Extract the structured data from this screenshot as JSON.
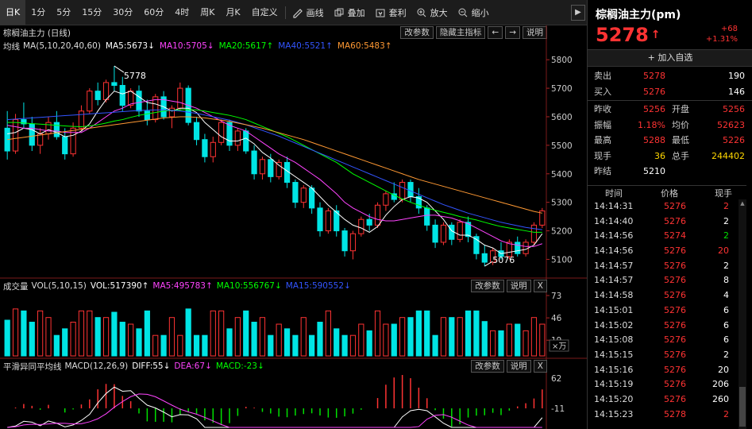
{
  "toolbar": {
    "periods": [
      "日K",
      "1分",
      "5分",
      "15分",
      "30分",
      "60分",
      "4时",
      "周K",
      "月K",
      "自定义"
    ],
    "active_period": "日K",
    "tools": [
      {
        "label": "画线",
        "icon": "pencil-icon"
      },
      {
        "label": "叠加",
        "icon": "overlay-icon"
      },
      {
        "label": "套利",
        "icon": "arbitrage-icon"
      },
      {
        "label": "放大",
        "icon": "zoom-in-icon"
      },
      {
        "label": "缩小",
        "icon": "zoom-out-icon"
      }
    ],
    "more": "▶"
  },
  "main_pane": {
    "title": "棕榈油主力 (日线)",
    "buttons": [
      "改参数",
      "隐藏主指标",
      "←",
      "→",
      "说明"
    ],
    "ma_label": "均线",
    "ma_params": "MA(5,10,20,40,60)",
    "ma_values": [
      {
        "text": "MA5:5673↓",
        "color": "#ffffff"
      },
      {
        "text": "MA10:5705↓",
        "color": "#ff44ff"
      },
      {
        "text": "MA20:5617↑",
        "color": "#00ff00"
      },
      {
        "text": "MA40:5521↑",
        "color": "#3355ff"
      },
      {
        "text": "MA60:5483↑",
        "color": "#ff9933"
      }
    ],
    "high_label": "5778",
    "low_label": "5076",
    "y_ticks": [
      "5800",
      "5700",
      "5600",
      "5500",
      "5400",
      "5300",
      "5200",
      "5100"
    ]
  },
  "vol_pane": {
    "label": "成交量",
    "params": "VOL(5,10,15)",
    "values": [
      {
        "text": "VOL:517390↑",
        "color": "#ffffff"
      },
      {
        "text": "MA5:495783↑",
        "color": "#ff44ff"
      },
      {
        "text": "MA10:556767↓",
        "color": "#00ff00"
      },
      {
        "text": "MA15:590552↓",
        "color": "#3355ff"
      }
    ],
    "buttons": [
      "改参数",
      "说明",
      "X"
    ],
    "y_ticks": [
      "73",
      "46",
      "19"
    ],
    "unit": "×万"
  },
  "macd_pane": {
    "label": "平滑异同平均线",
    "params": "MACD(12,26,9)",
    "values": [
      {
        "text": "DIFF:55↓",
        "color": "#ffffff"
      },
      {
        "text": "DEA:67↓",
        "color": "#ff44ff"
      },
      {
        "text": "MACD:-23↓",
        "color": "#00ff00"
      }
    ],
    "buttons": [
      "改参数",
      "说明",
      "X"
    ],
    "y_ticks": [
      "62",
      "-11"
    ]
  },
  "quote": {
    "name": "棕榈油主力(pm)",
    "price": "5278",
    "arrow": "↑",
    "change": "+68",
    "change_pct": "+1.31%",
    "add_fav": "+ 加入自选",
    "sell_label": "卖出",
    "sell_price": "5278",
    "sell_vol": "190",
    "buy_label": "买入",
    "buy_price": "5276",
    "buy_vol": "146",
    "rows": [
      {
        "l1": "昨收",
        "v1": "5256",
        "c1": "red",
        "l2": "开盘",
        "v2": "5256",
        "c2": "red"
      },
      {
        "l1": "振幅",
        "v1": "1.18%",
        "c1": "red",
        "l2": "均价",
        "v2": "52623",
        "c2": "red"
      },
      {
        "l1": "最高",
        "v1": "5288",
        "c1": "red",
        "l2": "最低",
        "v2": "5226",
        "c2": "red"
      },
      {
        "l1": "现手",
        "v1": "36",
        "c1": "yellow",
        "l2": "总手",
        "v2": "244402",
        "c2": "yellow"
      },
      {
        "l1": "昨结",
        "v1": "5210",
        "c1": "white",
        "l2": "",
        "v2": "",
        "c2": "white"
      }
    ]
  },
  "ticks": {
    "headers": [
      "时间",
      "价格",
      "现手"
    ],
    "rows": [
      {
        "time": "14:14:31",
        "price": "5276",
        "vol": "2",
        "color": "red"
      },
      {
        "time": "14:14:40",
        "price": "5276",
        "vol": "2",
        "color": "white"
      },
      {
        "time": "14:14:56",
        "price": "5274",
        "vol": "2",
        "color": "green"
      },
      {
        "time": "14:14:56",
        "price": "5276",
        "vol": "20",
        "color": "red"
      },
      {
        "time": "14:14:57",
        "price": "5276",
        "vol": "2",
        "color": "white"
      },
      {
        "time": "14:14:57",
        "price": "5276",
        "vol": "8",
        "color": "white"
      },
      {
        "time": "14:14:58",
        "price": "5276",
        "vol": "4",
        "color": "white"
      },
      {
        "time": "14:15:01",
        "price": "5276",
        "vol": "6",
        "color": "white"
      },
      {
        "time": "14:15:02",
        "price": "5276",
        "vol": "6",
        "color": "white"
      },
      {
        "time": "14:15:08",
        "price": "5276",
        "vol": "6",
        "color": "white"
      },
      {
        "time": "14:15:15",
        "price": "5276",
        "vol": "2",
        "color": "white"
      },
      {
        "time": "14:15:16",
        "price": "5276",
        "vol": "20",
        "color": "white"
      },
      {
        "time": "14:15:19",
        "price": "5276",
        "vol": "206",
        "color": "white"
      },
      {
        "time": "14:15:20",
        "price": "5276",
        "vol": "260",
        "color": "white"
      },
      {
        "time": "14:15:23",
        "price": "5278",
        "vol": "2",
        "color": "red"
      }
    ]
  },
  "chart_data": {
    "type": "candlestick",
    "title": "棕榈油主力 (日线)",
    "ylim": [
      5040,
      5820
    ],
    "ohlc": [
      [
        5560,
        5620,
        5450,
        5480
      ],
      [
        5480,
        5610,
        5470,
        5590
      ],
      [
        5590,
        5650,
        5560,
        5575
      ],
      [
        5575,
        5600,
        5480,
        5500
      ],
      [
        5500,
        5560,
        5470,
        5540
      ],
      [
        5540,
        5600,
        5520,
        5580
      ],
      [
        5580,
        5620,
        5520,
        5530
      ],
      [
        5530,
        5560,
        5450,
        5470
      ],
      [
        5470,
        5580,
        5460,
        5560
      ],
      [
        5560,
        5640,
        5550,
        5620
      ],
      [
        5620,
        5700,
        5610,
        5690
      ],
      [
        5690,
        5720,
        5640,
        5660
      ],
      [
        5660,
        5730,
        5650,
        5720
      ],
      [
        5720,
        5778,
        5690,
        5710
      ],
      [
        5710,
        5740,
        5620,
        5640
      ],
      [
        5640,
        5700,
        5630,
        5690
      ],
      [
        5690,
        5710,
        5600,
        5620
      ],
      [
        5620,
        5660,
        5570,
        5590
      ],
      [
        5590,
        5680,
        5580,
        5670
      ],
      [
        5670,
        5690,
        5590,
        5600
      ],
      [
        5600,
        5640,
        5560,
        5630
      ],
      [
        5630,
        5720,
        5620,
        5700
      ],
      [
        5700,
        5710,
        5570,
        5580
      ],
      [
        5580,
        5600,
        5500,
        5520
      ],
      [
        5520,
        5540,
        5440,
        5460
      ],
      [
        5460,
        5530,
        5440,
        5510
      ],
      [
        5510,
        5590,
        5500,
        5580
      ],
      [
        5580,
        5590,
        5480,
        5500
      ],
      [
        5500,
        5560,
        5480,
        5550
      ],
      [
        5550,
        5560,
        5470,
        5480
      ],
      [
        5480,
        5500,
        5380,
        5400
      ],
      [
        5400,
        5460,
        5380,
        5450
      ],
      [
        5450,
        5470,
        5370,
        5390
      ],
      [
        5390,
        5450,
        5380,
        5440
      ],
      [
        5440,
        5460,
        5350,
        5370
      ],
      [
        5370,
        5380,
        5280,
        5300
      ],
      [
        5300,
        5360,
        5280,
        5350
      ],
      [
        5350,
        5360,
        5260,
        5280
      ],
      [
        5280,
        5300,
        5180,
        5200
      ],
      [
        5200,
        5280,
        5190,
        5270
      ],
      [
        5270,
        5290,
        5180,
        5200
      ],
      [
        5200,
        5210,
        5110,
        5130
      ],
      [
        5130,
        5200,
        5100,
        5190
      ],
      [
        5190,
        5250,
        5180,
        5240
      ],
      [
        5240,
        5260,
        5200,
        5220
      ],
      [
        5220,
        5300,
        5210,
        5290
      ],
      [
        5290,
        5340,
        5270,
        5330
      ],
      [
        5330,
        5370,
        5300,
        5310
      ],
      [
        5310,
        5380,
        5300,
        5370
      ],
      [
        5370,
        5380,
        5300,
        5320
      ],
      [
        5320,
        5350,
        5260,
        5280
      ],
      [
        5280,
        5290,
        5200,
        5220
      ],
      [
        5220,
        5240,
        5140,
        5160
      ],
      [
        5160,
        5230,
        5150,
        5220
      ],
      [
        5220,
        5230,
        5150,
        5170
      ],
      [
        5170,
        5240,
        5160,
        5230
      ],
      [
        5230,
        5250,
        5160,
        5180
      ],
      [
        5180,
        5190,
        5100,
        5120
      ],
      [
        5120,
        5150,
        5076,
        5090
      ],
      [
        5090,
        5140,
        5080,
        5130
      ],
      [
        5130,
        5160,
        5100,
        5110
      ],
      [
        5110,
        5170,
        5100,
        5160
      ],
      [
        5160,
        5180,
        5110,
        5120
      ],
      [
        5120,
        5170,
        5110,
        5160
      ],
      [
        5160,
        5230,
        5150,
        5220
      ],
      [
        5220,
        5280,
        5210,
        5270
      ]
    ],
    "series": [
      {
        "name": "MA5",
        "color": "#ffffff",
        "values": [
          5540,
          5545,
          5560,
          5555,
          5540,
          5555,
          5545,
          5530,
          5535,
          5550,
          5575,
          5620,
          5660,
          5690,
          5680,
          5690,
          5670,
          5650,
          5645,
          5635,
          5620,
          5630,
          5630,
          5615,
          5580,
          5555,
          5530,
          5515,
          5515,
          5525,
          5505,
          5475,
          5455,
          5430,
          5410,
          5390,
          5370,
          5350,
          5320,
          5290,
          5265,
          5240,
          5220,
          5210,
          5195,
          5215,
          5255,
          5285,
          5310,
          5320,
          5315,
          5300,
          5270,
          5240,
          5200,
          5185,
          5185,
          5170,
          5150,
          5140,
          5120,
          5125,
          5130,
          5135,
          5150,
          5190
        ]
      },
      {
        "name": "MA10",
        "color": "#ff44ff",
        "values": [
          5570,
          5565,
          5560,
          5560,
          5555,
          5550,
          5550,
          5545,
          5545,
          5545,
          5560,
          5580,
          5600,
          5620,
          5630,
          5645,
          5650,
          5655,
          5660,
          5660,
          5655,
          5650,
          5640,
          5630,
          5615,
          5600,
          5585,
          5570,
          5560,
          5550,
          5530,
          5510,
          5490,
          5470,
          5455,
          5440,
          5420,
          5400,
          5380,
          5355,
          5330,
          5300,
          5280,
          5265,
          5250,
          5240,
          5235,
          5235,
          5240,
          5245,
          5250,
          5255,
          5255,
          5250,
          5245,
          5235,
          5225,
          5210,
          5195,
          5180,
          5165,
          5155,
          5150,
          5145,
          5145,
          5155
        ]
      },
      {
        "name": "MA20",
        "color": "#00ff00",
        "values": [
          5580,
          5580,
          5578,
          5576,
          5574,
          5572,
          5570,
          5568,
          5566,
          5565,
          5568,
          5572,
          5578,
          5585,
          5590,
          5598,
          5605,
          5610,
          5615,
          5620,
          5622,
          5624,
          5625,
          5624,
          5620,
          5615,
          5610,
          5605,
          5598,
          5590,
          5578,
          5566,
          5554,
          5542,
          5530,
          5515,
          5500,
          5485,
          5470,
          5455,
          5440,
          5420,
          5400,
          5385,
          5370,
          5355,
          5340,
          5325,
          5312,
          5300,
          5290,
          5280,
          5272,
          5265,
          5258,
          5250,
          5244,
          5238,
          5230,
          5222,
          5215,
          5210,
          5205,
          5200,
          5195,
          5195
        ]
      },
      {
        "name": "MA40",
        "color": "#3355ff",
        "values": [
          5590,
          5592,
          5594,
          5596,
          5598,
          5600,
          5602,
          5604,
          5606,
          5608,
          5610,
          5612,
          5614,
          5616,
          5618,
          5620,
          5622,
          5623,
          5624,
          5624,
          5622,
          5620,
          5616,
          5612,
          5606,
          5600,
          5594,
          5588,
          5580,
          5572,
          5562,
          5552,
          5542,
          5532,
          5520,
          5508,
          5496,
          5484,
          5472,
          5460,
          5448,
          5436,
          5424,
          5412,
          5400,
          5388,
          5376,
          5364,
          5352,
          5340,
          5328,
          5316,
          5304,
          5292,
          5282,
          5272,
          5262,
          5254,
          5246,
          5238,
          5230,
          5224,
          5218,
          5212,
          5208,
          5204
        ]
      },
      {
        "name": "MA60",
        "color": "#ff9933",
        "values": [
          5520,
          5524,
          5528,
          5532,
          5536,
          5540,
          5544,
          5548,
          5552,
          5556,
          5560,
          5564,
          5568,
          5572,
          5576,
          5580,
          5584,
          5588,
          5592,
          5596,
          5598,
          5600,
          5600,
          5598,
          5596,
          5592,
          5588,
          5584,
          5578,
          5572,
          5566,
          5560,
          5552,
          5544,
          5536,
          5528,
          5520,
          5510,
          5500,
          5490,
          5480,
          5470,
          5460,
          5450,
          5440,
          5430,
          5420,
          5410,
          5400,
          5390,
          5380,
          5372,
          5364,
          5356,
          5348,
          5340,
          5332,
          5324,
          5316,
          5308,
          5300,
          5292,
          5284,
          5276,
          5268,
          5262
        ]
      }
    ]
  }
}
